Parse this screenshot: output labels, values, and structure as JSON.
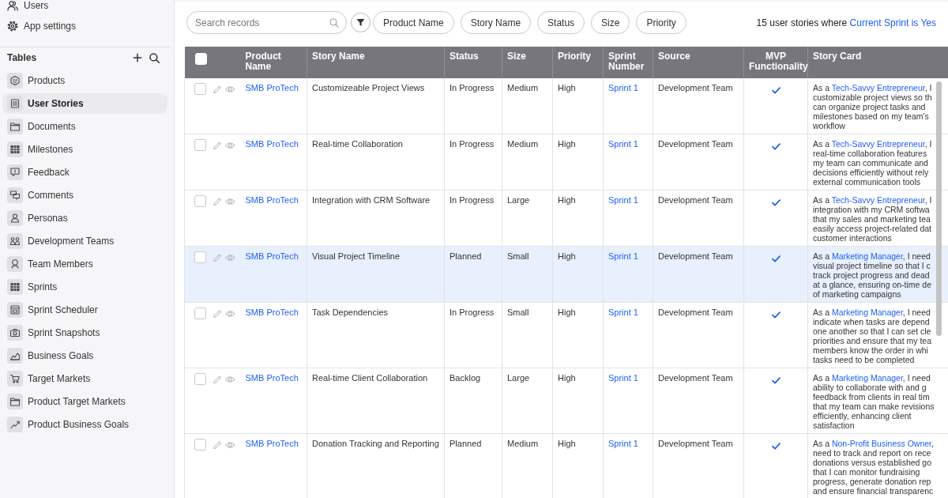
{
  "sidebar": {
    "nav": [
      {
        "label": "Users"
      },
      {
        "label": "App settings"
      }
    ],
    "tables_heading": "Tables",
    "tables": [
      {
        "label": "Products",
        "selected": false
      },
      {
        "label": "User Stories",
        "selected": true
      },
      {
        "label": "Documents",
        "selected": false
      },
      {
        "label": "Milestones",
        "selected": false
      },
      {
        "label": "Feedback",
        "selected": false
      },
      {
        "label": "Comments",
        "selected": false
      },
      {
        "label": "Personas",
        "selected": false
      },
      {
        "label": "Development Teams",
        "selected": false
      },
      {
        "label": "Team Members",
        "selected": false
      },
      {
        "label": "Sprints",
        "selected": false
      },
      {
        "label": "Sprint Scheduler",
        "selected": false
      },
      {
        "label": "Sprint Snapshots",
        "selected": false
      },
      {
        "label": "Business Goals",
        "selected": false
      },
      {
        "label": "Target Markets",
        "selected": false
      },
      {
        "label": "Product Target Markets",
        "selected": false
      },
      {
        "label": "Product Business Goals",
        "selected": false
      }
    ]
  },
  "toolbar": {
    "search": {
      "placeholder": "Search records"
    },
    "chips": [
      "Product Name",
      "Story Name",
      "Status",
      "Size",
      "Priority"
    ],
    "summary": {
      "text": "15 user stories where",
      "filter": "Current Sprint is Yes"
    }
  },
  "table": {
    "select_all": {
      "checked": false
    },
    "columns": [
      "Product Name",
      "Story Name",
      "Status",
      "Size",
      "Priority",
      "Sprint Number",
      "Source",
      "MVP Functionality",
      "Story Card"
    ],
    "rows": [
      {
        "checked": false,
        "selected": false,
        "product": "SMB ProTech",
        "story_name": "Customizeable Project Views",
        "status": "In Progress",
        "size": "Medium",
        "priority": "High",
        "sprint": "Sprint 1",
        "source": "Development Team",
        "mvp": true,
        "story_card": {
          "lead": "As a",
          "persona": "Tech-Savvy Entrepreneur",
          "rest": ", I",
          "lines": [
            "customizable project views so th",
            "can organize project tasks and",
            "milestones based on my team's",
            "workflow"
          ]
        }
      },
      {
        "checked": false,
        "selected": false,
        "product": "SMB ProTech",
        "story_name": "Real-time Collaboration",
        "status": "In Progress",
        "size": "Medium",
        "priority": "High",
        "sprint": "Sprint 1",
        "source": "Development Team",
        "mvp": true,
        "story_card": {
          "lead": "As a",
          "persona": "Tech-Savvy Entrepreneur",
          "rest": ", I",
          "lines": [
            "real-time collaboration features",
            "my team can communicate and",
            "decisions efficiently without rely",
            "external communication tools"
          ]
        }
      },
      {
        "checked": false,
        "selected": false,
        "product": "SMB ProTech",
        "story_name": "Integration with CRM Software",
        "status": "In Progress",
        "size": "Large",
        "priority": "High",
        "sprint": "Sprint 1",
        "source": "Development Team",
        "mvp": true,
        "story_card": {
          "lead": "As a",
          "persona": "Tech-Savvy Entrepreneur",
          "rest": ", I",
          "lines": [
            "integration with my CRM softwa",
            "that my sales and marketing tea",
            "easily access project-related dat",
            "customer interactions"
          ]
        }
      },
      {
        "checked": false,
        "selected": true,
        "product": "SMB ProTech",
        "story_name": "Visual Project Timeline",
        "status": "Planned",
        "size": "Small",
        "priority": "High",
        "sprint": "Sprint 1",
        "source": "Development Team",
        "mvp": true,
        "story_card": {
          "lead": "As a",
          "persona": "Marketing Manager",
          "rest": ", I need",
          "lines": [
            "visual project timeline so that I c",
            "track project progress and dead",
            "at a glance, ensuring on-time de",
            "of marketing campaigns"
          ]
        }
      },
      {
        "checked": false,
        "selected": false,
        "product": "SMB ProTech",
        "story_name": "Task Dependencies",
        "status": "In Progress",
        "size": "Small",
        "priority": "High",
        "sprint": "Sprint 1",
        "source": "Development Team",
        "mvp": true,
        "story_card": {
          "lead": "As a",
          "persona": "Marketing Manager",
          "rest": ", I need",
          "lines": [
            "indicate when tasks are depend",
            "one another so that I can set cle",
            "priorities and ensure that my tea",
            "members know the order in whi",
            "tasks need to be completed"
          ]
        }
      },
      {
        "checked": false,
        "selected": false,
        "product": "SMB ProTech",
        "story_name": "Real-time Client Collaboration",
        "status": "Backlog",
        "size": "Large",
        "priority": "High",
        "sprint": "Sprint 1",
        "source": "Development Team",
        "mvp": true,
        "story_card": {
          "lead": "As a",
          "persona": "Marketing Manager",
          "rest": ", I need",
          "lines": [
            "ability to collaborate with and g",
            "feedback from clients in real tim",
            "that my team can make revisions",
            "efficiently, enhancing client",
            "satisfaction"
          ]
        }
      },
      {
        "checked": false,
        "selected": false,
        "product": "SMB ProTech",
        "story_name": "Donation Tracking and Reporting",
        "status": "Planned",
        "size": "Medium",
        "priority": "High",
        "sprint": "Sprint 1",
        "source": "Development Team",
        "mvp": true,
        "story_card": {
          "lead": "As a",
          "persona": "Non-Profit Business Owner",
          "rest": ",",
          "lines": [
            "need to track and report on rece",
            "donations versus established go",
            "that I can monitor fundraising",
            "progress, generate donation rep",
            "and ensure financial transparenc"
          ]
        }
      }
    ]
  }
}
